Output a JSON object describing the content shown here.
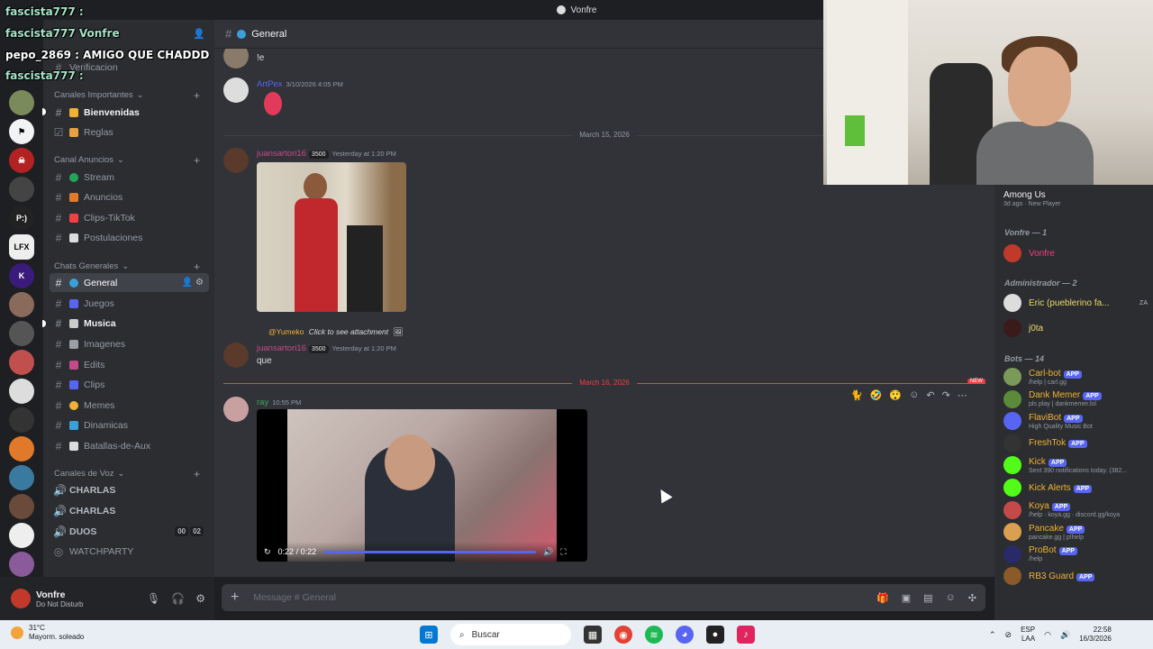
{
  "window": {
    "title": "Vonfre"
  },
  "overlay_chat": [
    {
      "user": "fascista777 :"
    },
    {
      "user": "fascista777 Vonfre"
    },
    {
      "user": "pepo_2869 : AMIGO QUE CHADDD"
    },
    {
      "user": "fascista777 :"
    }
  ],
  "guild_labels": [
    "P:)",
    "LFX"
  ],
  "server": {
    "verificacion": "Verificacion"
  },
  "categories": {
    "importantes": "Canales Importantes",
    "anuncios": "Canal Anuncios",
    "generales": "Chats Generales",
    "voz": "Canales de Voz"
  },
  "channels": {
    "bienvenidas": "Bienvenidas",
    "reglas": "Reglas",
    "stream": "Stream",
    "anuncios": "Anuncios",
    "clips_tiktok": "Clips-TikTok",
    "postulaciones": "Postulaciones",
    "general": "General",
    "juegos": "Juegos",
    "musica": "Musica",
    "imagenes": "Imagenes",
    "edits": "Edits",
    "clips": "Clips",
    "memes": "Memes",
    "dinamicas": "Dinamicas",
    "batallas": "Batallas-de-Aux"
  },
  "voice": {
    "charlas1": "CHARLAS",
    "charlas2": "CHARLAS",
    "duos": "DUOS",
    "duos_count_a": "00",
    "duos_count_b": "02",
    "watchparty": "WATCHPARTY"
  },
  "user_panel": {
    "name": "Vonfre",
    "status": "Do Not Disturb"
  },
  "chat_header": {
    "channel": "General"
  },
  "messages": {
    "m0_text": "!e",
    "artpex_name": "ArtPex",
    "artpex_ts": "3/10/2026 4:05 PM",
    "div1": "March 15, 2026",
    "juan_name": "juansartori16",
    "juan_badge": "3500",
    "juan_ts": "Yesterday at 1:20 PM",
    "reply_user": "@Yumeko",
    "reply_text": "Click to see attachment",
    "juan2_text": "que",
    "div2": "March 16, 2026",
    "ray_name": "ray",
    "ray_ts": "10:55 PM",
    "video_time": "0:22 / 0:22",
    "new_label": "NEW"
  },
  "composer": {
    "placeholder": "Message # General"
  },
  "members": {
    "among_us": "Among Us",
    "among_sub_a": "3d ago",
    "among_sub_b": "New Player",
    "vonfre_group": "Vonfre — 1",
    "vonfre_member": "Vonfre",
    "admin_group": "Administrador — 2",
    "eric": "Eric (pueblerino fa...",
    "eric_tag": "ZA",
    "jota": "j0ta",
    "bots_group": "Bots — 14",
    "app": "APP",
    "bots": [
      {
        "name": "Carl-bot",
        "sub": "/help | carl.gg",
        "color": "#f0b232"
      },
      {
        "name": "Dank Memer",
        "sub": "pls play | dankmemer.lol",
        "color": "#f0b232"
      },
      {
        "name": "FlaviBot",
        "sub": "High Quality Music Bot",
        "color": "#f0b232"
      },
      {
        "name": "FreshTok",
        "sub": "",
        "color": "#f0b232"
      },
      {
        "name": "Kick",
        "sub": "Sent 390 notifications today. (382...",
        "color": "#f0b232"
      },
      {
        "name": "Kick Alerts",
        "sub": "",
        "color": "#f0b232"
      },
      {
        "name": "Koya",
        "sub": "/help · koya.gg · discord.gg/koya",
        "color": "#f0b232"
      },
      {
        "name": "Pancake",
        "sub": "pancake.gg | p!help",
        "color": "#f0b232"
      },
      {
        "name": "ProBot",
        "sub": "/help",
        "color": "#f0b232"
      },
      {
        "name": "RB3 Guard",
        "sub": "",
        "color": "#f0b232"
      }
    ]
  },
  "taskbar": {
    "temp": "31°C",
    "weather": "Mayorm. soleado",
    "search": "Buscar",
    "lang_a": "ESP",
    "lang_b": "LAA",
    "time": "22:58",
    "date": "16/3/2026"
  }
}
